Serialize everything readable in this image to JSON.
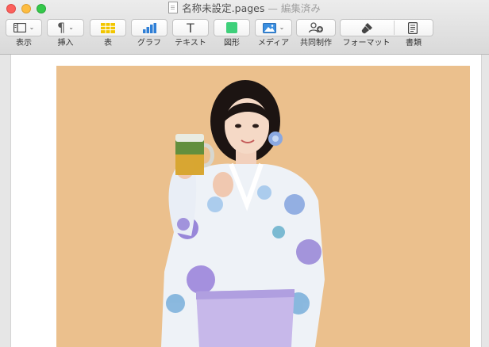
{
  "window": {
    "title": "名称未設定.pages",
    "status": "— 編集済み"
  },
  "toolbar": {
    "items": [
      {
        "label": "表示",
        "icon": "sidebar-view-icon"
      },
      {
        "label": "挿入",
        "icon": "pilcrow-icon"
      },
      {
        "label": "表",
        "icon": "table-icon"
      },
      {
        "label": "グラフ",
        "icon": "bar-chart-icon"
      },
      {
        "label": "テキスト",
        "icon": "text-icon"
      },
      {
        "label": "図形",
        "icon": "shape-icon"
      },
      {
        "label": "メディア",
        "icon": "media-icon"
      },
      {
        "label": "共同制作",
        "icon": "collaborate-icon"
      },
      {
        "label": "フォーマット",
        "icon": "format-brush-icon"
      },
      {
        "label": "書類",
        "icon": "document-icon"
      }
    ],
    "insert_glyph": "¶",
    "text_glyph": "T"
  },
  "document": {
    "image": {
      "subject": "woman in yukata holding beer mug",
      "background_color": "#ebc08d"
    }
  },
  "colors": {
    "table_icon": "#f2c600",
    "chart_icon": "#2f7fd6",
    "shape_icon": "#3ed07a",
    "media_icon": "#3b8fe0"
  }
}
